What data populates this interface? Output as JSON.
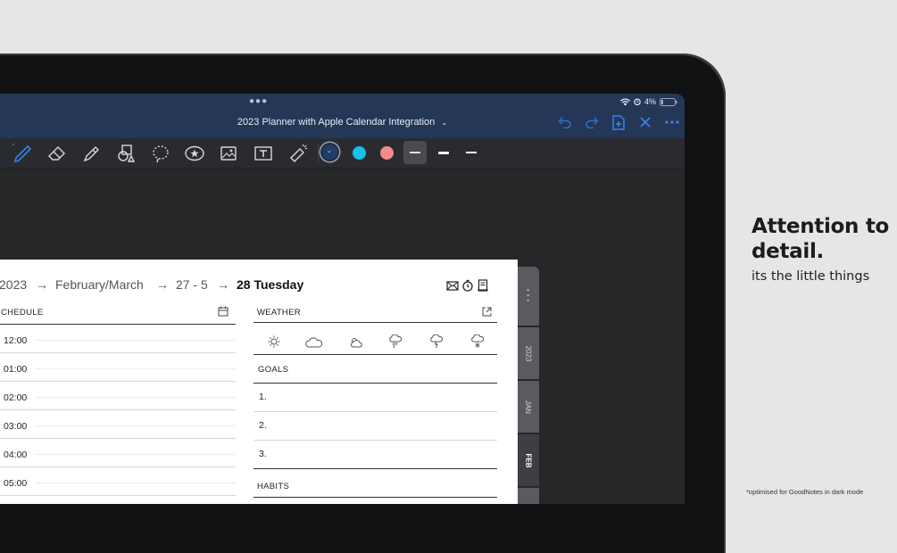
{
  "statusbar": {
    "battery": "4%"
  },
  "navbar": {
    "title": "2023 Planner with Apple Calendar Integration"
  },
  "toolbar": {
    "colors": {
      "dark_blue": "#1e3d6b",
      "cyan": "#16c1ec",
      "pink": "#f28b8b"
    }
  },
  "breadcrumb": {
    "year": "2023",
    "month": "February/March",
    "week": "27 - 5",
    "day_num": "28",
    "day_name": "Tuesday"
  },
  "schedule": {
    "heading": "CHEDULE",
    "times": [
      "12:00",
      "01:00",
      "02:00",
      "03:00",
      "04:00",
      "05:00"
    ]
  },
  "weather": {
    "heading": "WEATHER"
  },
  "goals": {
    "heading": "GOALS",
    "items": [
      "1.",
      "2.",
      "3."
    ]
  },
  "habits": {
    "heading": "HABITS"
  },
  "tabs": {
    "year": "2023",
    "jan": "JAN",
    "feb": "FEB"
  },
  "marketing": {
    "title_line1": "Attention to",
    "title_line2": "detail.",
    "subtitle": "its the little things",
    "footnote": "*optimised for GoodNotes in dark mode"
  }
}
